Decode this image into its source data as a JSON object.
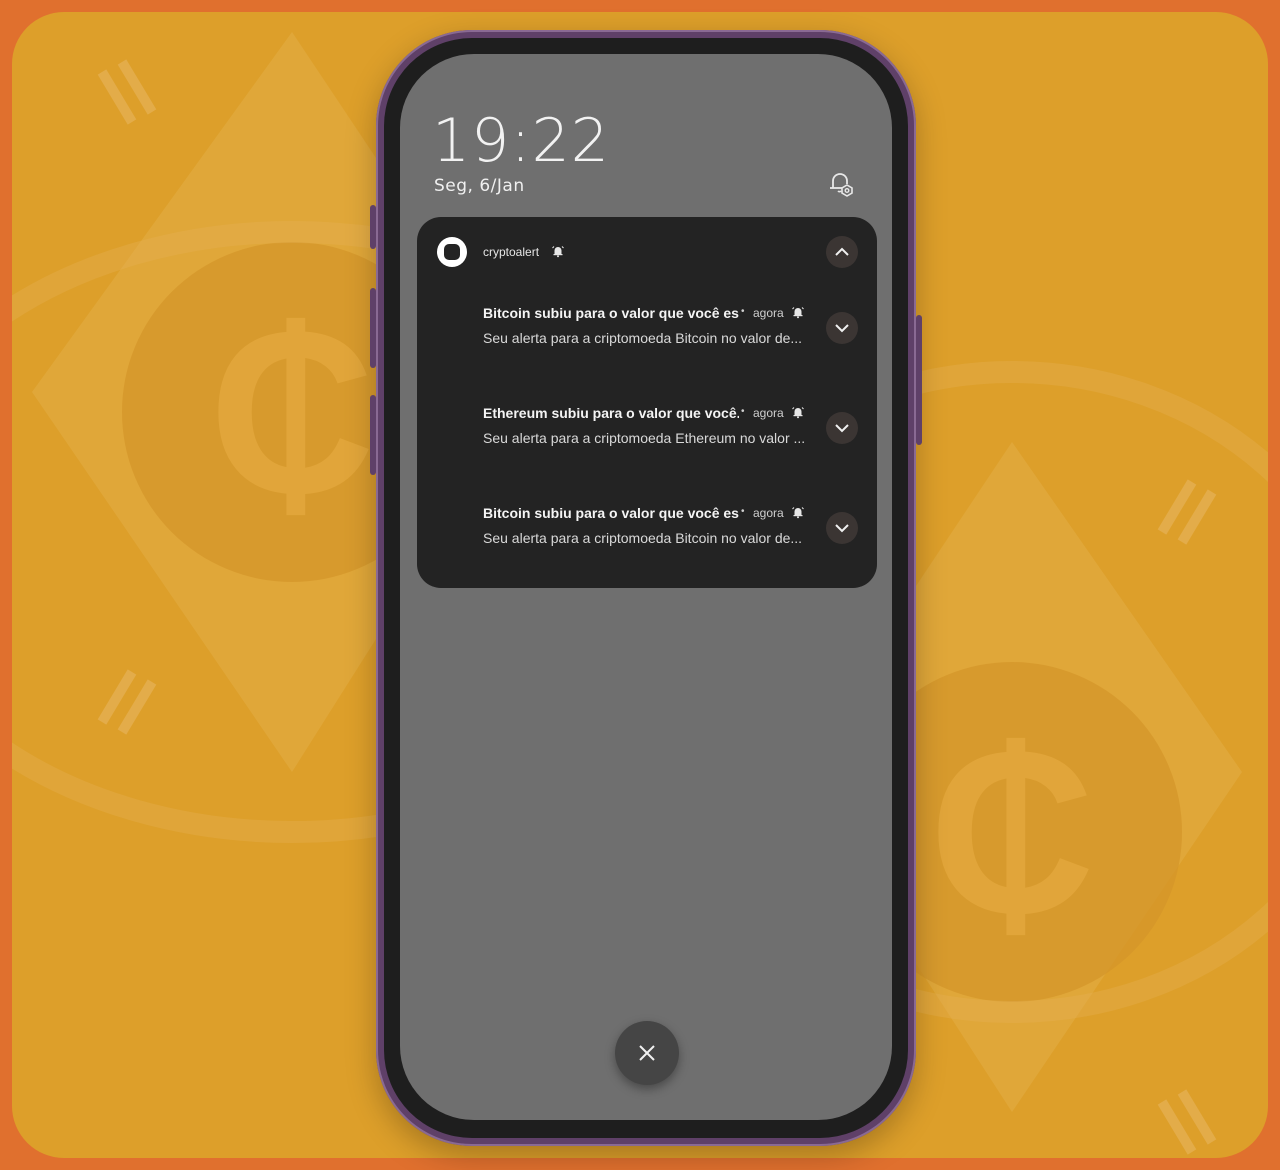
{
  "lockscreen": {
    "time": "19:22",
    "date": "Seg, 6/Jan"
  },
  "notification_group": {
    "app_name": "cryptoalert",
    "items": [
      {
        "title": "Bitcoin subiu para o valor que você es...",
        "time": "agora",
        "body": "Seu alerta para a criptomoeda Bitcoin no valor de..."
      },
      {
        "title": "Ethereum subiu para o valor que você...",
        "time": "agora",
        "body": "Seu alerta para a criptomoeda Ethereum no valor ..."
      },
      {
        "title": "Bitcoin subiu para o valor que você es...",
        "time": "agora",
        "body": "Seu alerta para a criptomoeda Bitcoin no valor de..."
      }
    ]
  },
  "separator": "•",
  "icons": {
    "notification_settings": "bell-settings-icon",
    "alarm": "bell-ringing-icon",
    "collapse": "chevron-up-icon",
    "expand": "chevron-down-icon",
    "clear": "close-icon"
  },
  "colors": {
    "outer_border": "#e0702e",
    "background": "#dd9f2a",
    "phone_frame": "#5f4068",
    "screen": "#6f6f6f",
    "panel": "#232323"
  }
}
